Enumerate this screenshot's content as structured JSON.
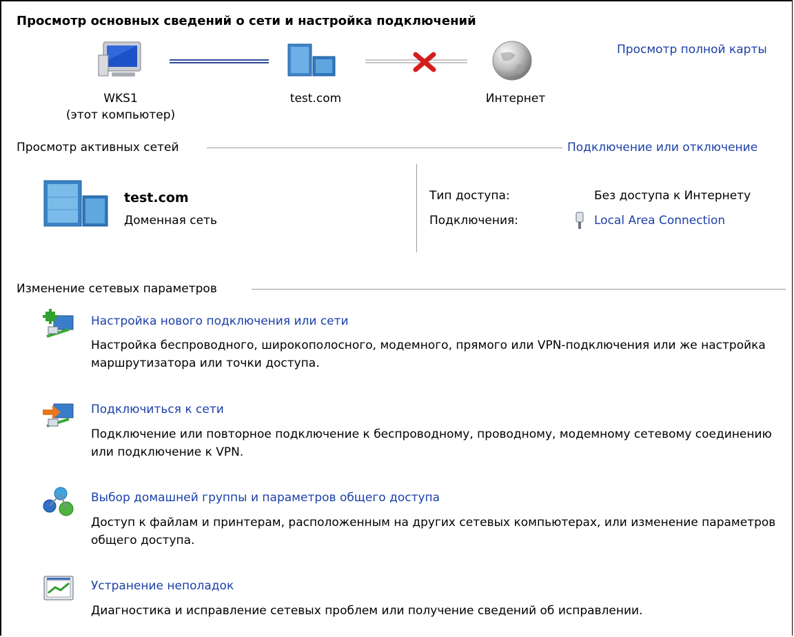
{
  "header": {
    "title": "Просмотр основных сведений о сети и настройка подключений",
    "full_map_link": "Просмотр полной карты"
  },
  "network_map": {
    "computer": {
      "name": "WKS1",
      "note": "(этот компьютер)",
      "icon": "computer-icon"
    },
    "domain": {
      "name": "test.com",
      "icon": "domain-server-icon"
    },
    "internet": {
      "name": "Интернет",
      "icon": "globe-icon"
    },
    "link_status_icon": "red-x-icon"
  },
  "active_networks": {
    "heading": "Просмотр активных сетей",
    "connect_link": "Подключение или отключение",
    "network_name": "test.com",
    "network_type": "Доменная сеть",
    "access_label": "Тип доступа:",
    "access_value": "Без доступа к Интернету",
    "connections_label": "Подключения:",
    "connection_link": "Local Area Connection",
    "connection_icon": "network-adapter-icon"
  },
  "change_settings": {
    "heading": "Изменение сетевых параметров",
    "items": [
      {
        "icon": "new-connection-icon",
        "title": "Настройка нового подключения или сети",
        "desc": "Настройка беспроводного, широкополосного, модемного, прямого или VPN-подключения или же настройка маршрутизатора или точки доступа."
      },
      {
        "icon": "connect-network-icon",
        "title": "Подключиться к сети",
        "desc": "Подключение или повторное подключение к беспроводному, проводному, модемному сетевому соединению или подключение к VPN."
      },
      {
        "icon": "homegroup-icon",
        "title": "Выбор домашней группы и параметров общего доступа",
        "desc": "Доступ к файлам и принтерам, расположенным на других сетевых компьютерах, или изменение параметров общего доступа."
      },
      {
        "icon": "troubleshoot-icon",
        "title": "Устранение неполадок",
        "desc": "Диагностика и исправление сетевых проблем или получение сведений об исправлении."
      }
    ]
  }
}
